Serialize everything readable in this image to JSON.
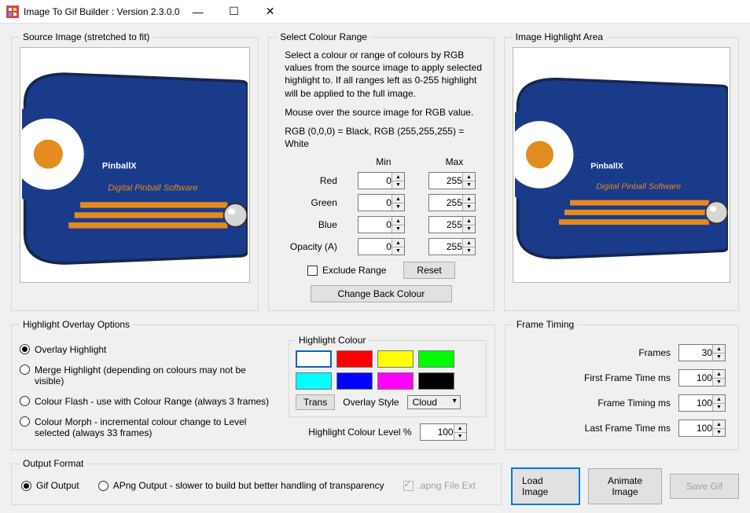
{
  "window": {
    "title": "Image To Gif Builder : Version 2.3.0.0"
  },
  "source_image": {
    "legend": "Source Image (stretched to fit)"
  },
  "image_highlight": {
    "legend": "Image Highlight Area"
  },
  "colour_range": {
    "legend": "Select Colour Range",
    "desc1": "Select a colour or range of colours by RGB values from the source image to apply selected highlight to. If all ranges left as 0-255 highlight will be applied to the full image.",
    "desc2": "Mouse over the source image for RGB value.",
    "desc3": "RGB (0,0,0) = Black, RGB (255,255,255) = White",
    "min_label": "Min",
    "max_label": "Max",
    "rows": {
      "red": {
        "label": "Red",
        "min": "0",
        "max": "255"
      },
      "green": {
        "label": "Green",
        "min": "0",
        "max": "255"
      },
      "blue": {
        "label": "Blue",
        "min": "0",
        "max": "255"
      },
      "opacity": {
        "label": "Opacity (A)",
        "min": "0",
        "max": "255"
      }
    },
    "exclude_label": "Exclude Range",
    "reset_label": "Reset",
    "change_back_label": "Change Back Colour"
  },
  "overlay": {
    "legend": "Highlight Overlay Options",
    "radios": {
      "overlay": "Overlay Highlight",
      "merge": "Merge Highlight (depending on colours may not be visible)",
      "flash": "Colour Flash - use with Colour Range (always 3 frames)",
      "morph": "Colour Morph - incremental colour change to Level selected (always 33 frames)"
    },
    "highlight_colour_legend": "Highlight Colour",
    "colours": {
      "white": "#ffffff",
      "red": "#ff0000",
      "yellow": "#ffff00",
      "green": "#00ff00",
      "cyan": "#00ffff",
      "blue": "#0000ff",
      "magenta": "#ff00ff",
      "black": "#000000"
    },
    "trans_label": "Trans",
    "style_label": "Overlay Style",
    "style_value": "Cloud",
    "level_label": "Highlight Colour Level %",
    "level_value": "100"
  },
  "timing": {
    "legend": "Frame Timing",
    "frames_label": "Frames",
    "frames_value": "30",
    "first_label": "First Frame Time ms",
    "first_value": "100",
    "frame_label": "Frame Timing ms",
    "frame_value": "100",
    "last_label": "Last Frame Time ms",
    "last_value": "100"
  },
  "output": {
    "legend": "Output Format",
    "gif_label": "Gif Output",
    "apng_label": "APng Output - slower to build but better handling of transparency",
    "apng_ext_label": ".apng File Ext"
  },
  "actions": {
    "load": "Load Image",
    "animate": "Animate Image",
    "save": "Save Gif"
  },
  "logo": {
    "brand_text": "PinballX",
    "tagline": "Digital Pinball Software"
  }
}
